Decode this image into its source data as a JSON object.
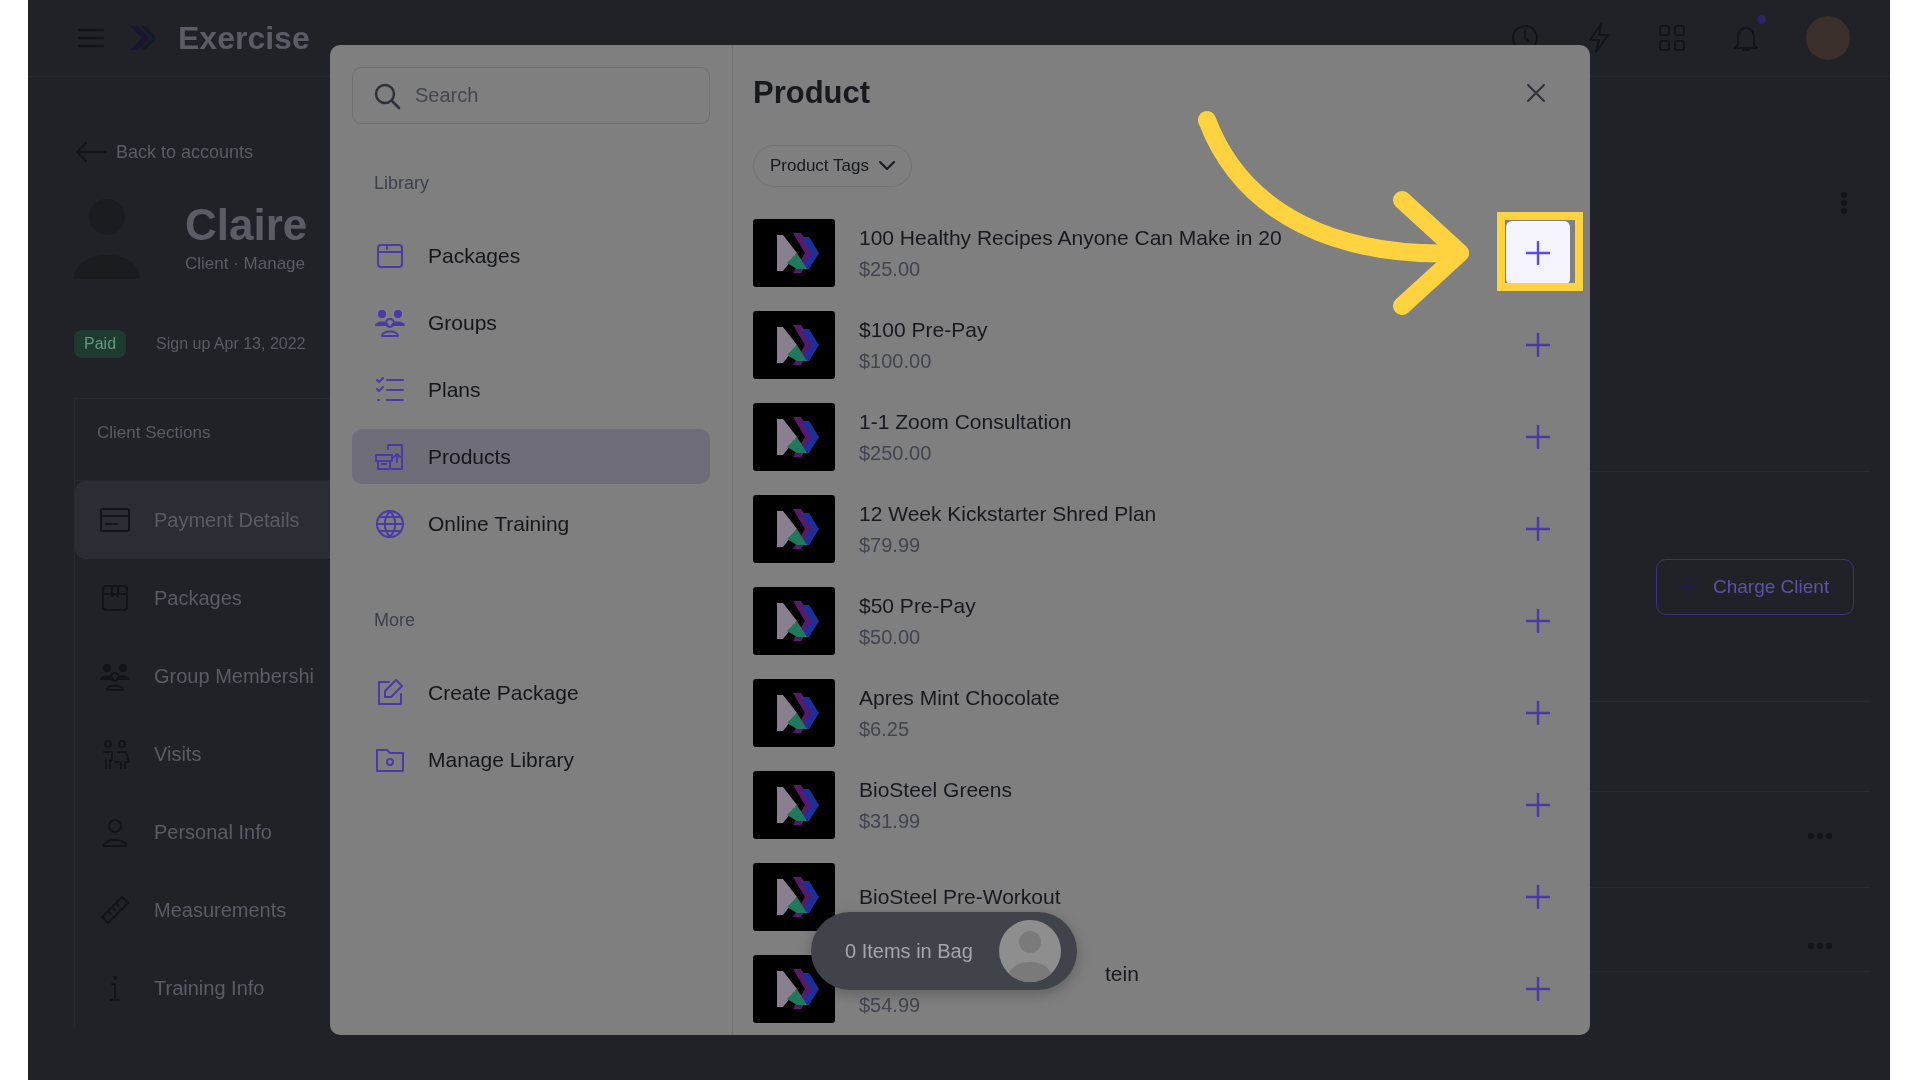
{
  "top_bar": {
    "app_name": "Exercise",
    "notification_dot": true
  },
  "client": {
    "back_link": "Back to accounts",
    "name": "Claire",
    "meta": "Client · Manage",
    "status_badge": "Paid",
    "signup": "Sign up Apr 13, 2022",
    "sections_title": "Client Sections",
    "sections": [
      {
        "label": "Payment Details",
        "selected": true
      },
      {
        "label": "Packages",
        "selected": false
      },
      {
        "label": "Group Membershi",
        "selected": false
      },
      {
        "label": "Visits",
        "selected": false
      },
      {
        "label": "Personal Info",
        "selected": false
      },
      {
        "label": "Measurements",
        "selected": false
      },
      {
        "label": "Training Info",
        "selected": false
      }
    ],
    "charge_button": "Charge Client"
  },
  "modal": {
    "search": {
      "placeholder": "Search"
    },
    "groups": [
      {
        "title": "Library",
        "items": [
          {
            "label": "Packages",
            "selected": false
          },
          {
            "label": "Groups",
            "selected": false
          },
          {
            "label": "Plans",
            "selected": false
          },
          {
            "label": "Products",
            "selected": true
          },
          {
            "label": "Online Training",
            "selected": false
          }
        ]
      },
      {
        "title": "More",
        "items": [
          {
            "label": "Create Package",
            "selected": false
          },
          {
            "label": "Manage Library",
            "selected": false
          }
        ]
      }
    ],
    "title": "Product",
    "filter": "Product Tags",
    "products": [
      {
        "name": "100 Healthy Recipes Anyone Can Make in 20",
        "price": "$25.00",
        "highlighted": true,
        "covered": false
      },
      {
        "name": "$100 Pre-Pay",
        "price": "$100.00",
        "highlighted": false,
        "covered": false
      },
      {
        "name": "1-1 Zoom Consultation",
        "price": "$250.00",
        "highlighted": false,
        "covered": false
      },
      {
        "name": "12 Week Kickstarter Shred Plan",
        "price": "$79.99",
        "highlighted": false,
        "covered": false
      },
      {
        "name": "$50 Pre-Pay",
        "price": "$50.00",
        "highlighted": false,
        "covered": false
      },
      {
        "name": "Apres Mint Chocolate",
        "price": "$6.25",
        "highlighted": false,
        "covered": false
      },
      {
        "name": "BioSteel Greens",
        "price": "$31.99",
        "highlighted": false,
        "covered": false
      },
      {
        "name": "BioSteel Pre-Workout",
        "highlighted": false,
        "covered": false
      },
      {
        "name": "tein",
        "price": "$54.99",
        "highlighted": false,
        "covered": true
      }
    ],
    "bag": {
      "label": "0 Items in Bag"
    }
  }
}
